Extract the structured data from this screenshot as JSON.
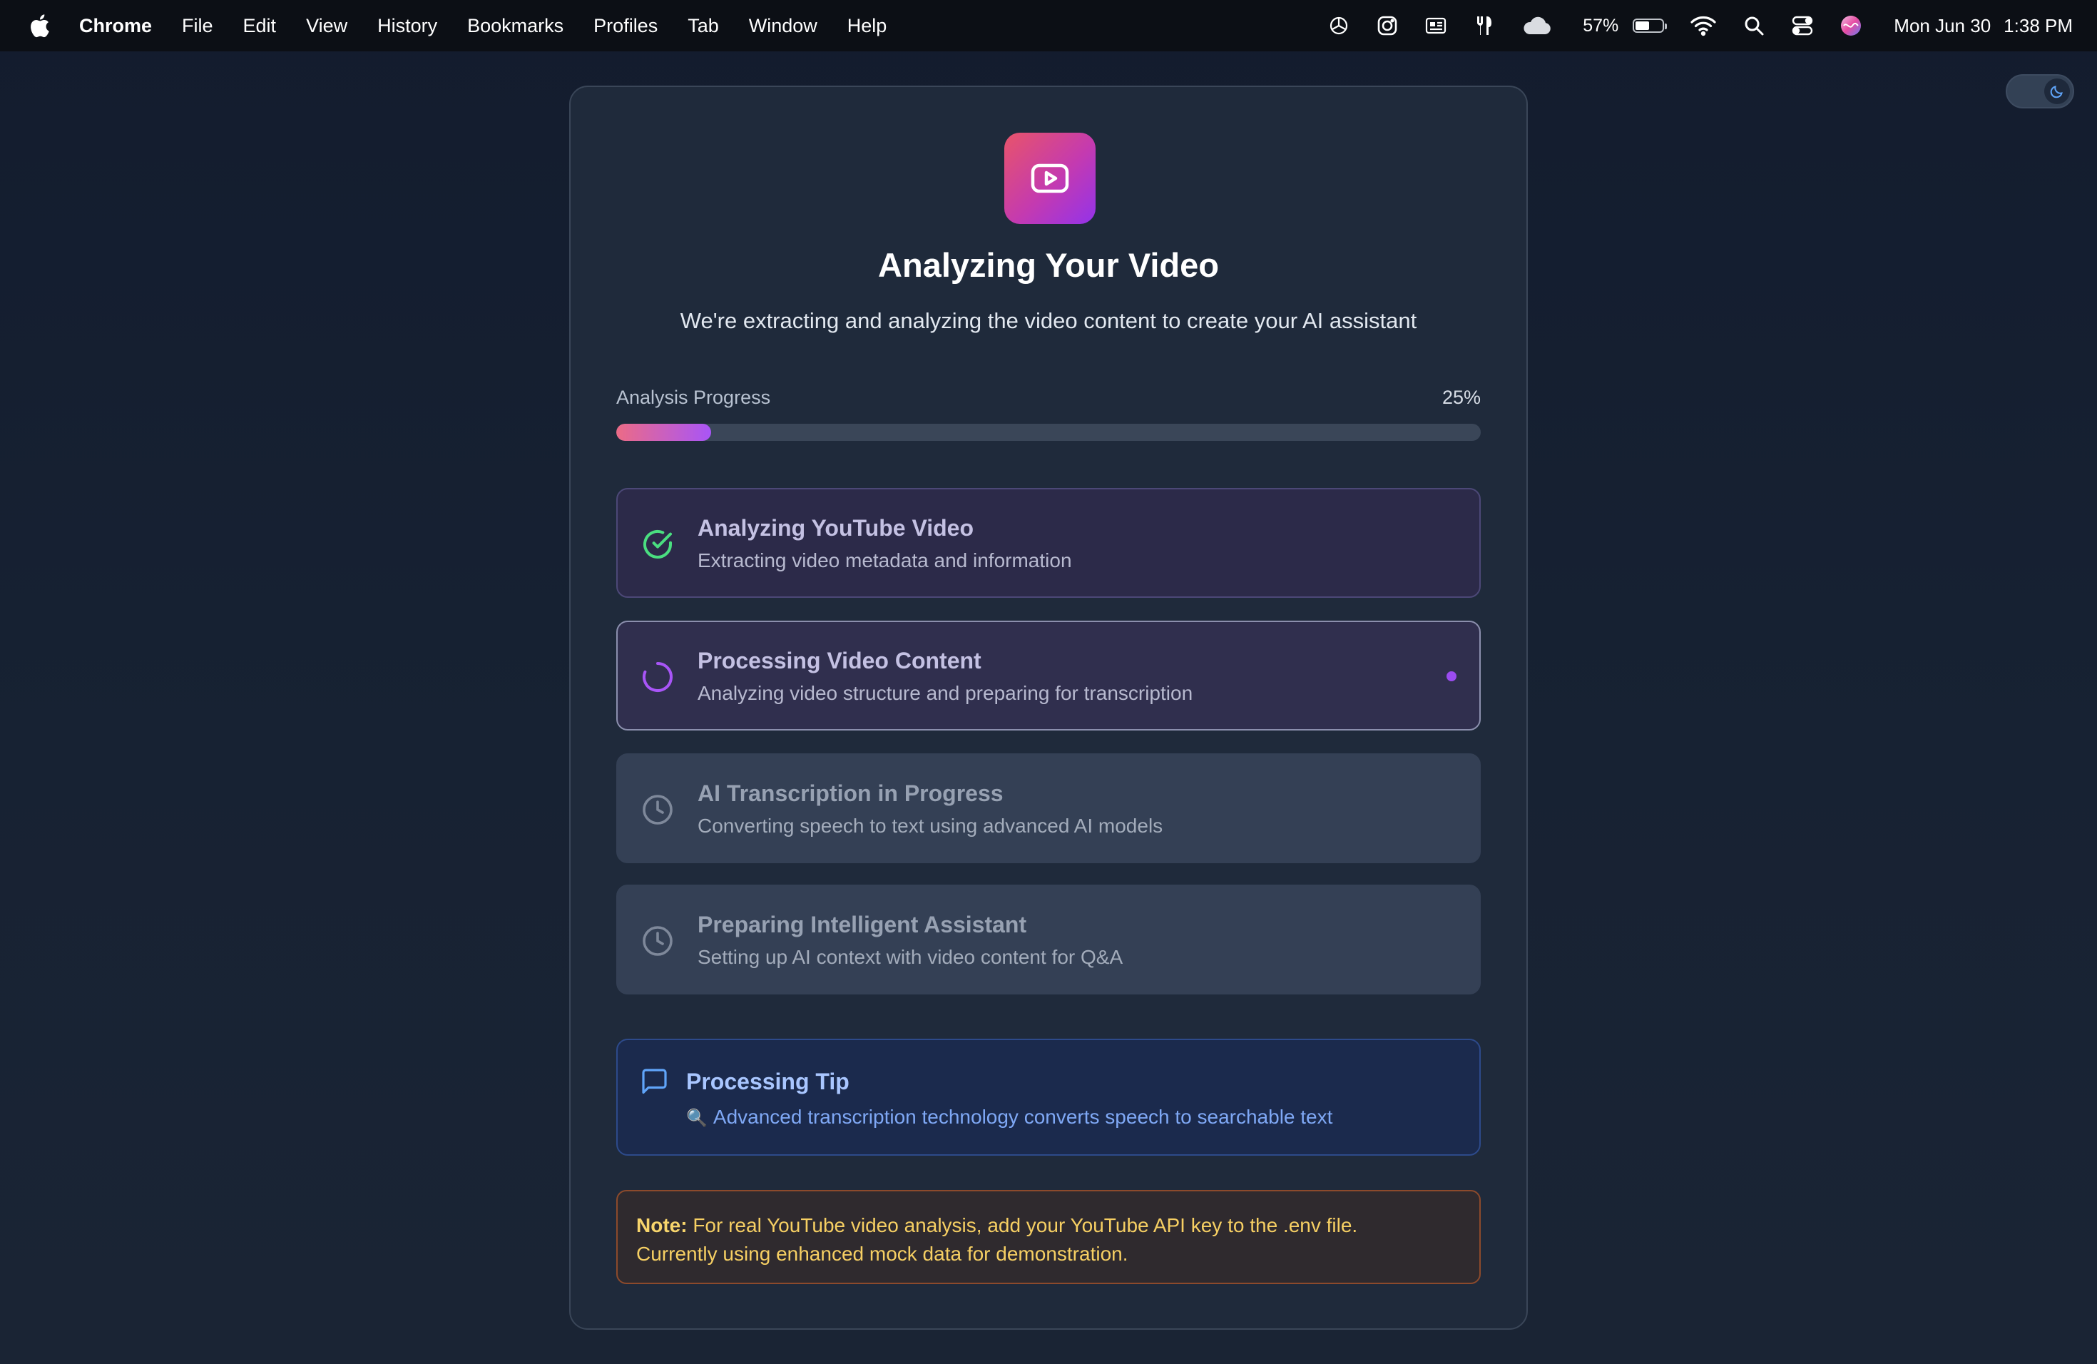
{
  "menubar": {
    "app_name": "Chrome",
    "items": [
      "File",
      "Edit",
      "View",
      "History",
      "Bookmarks",
      "Profiles",
      "Tab",
      "Window",
      "Help"
    ],
    "battery_percent": "57%",
    "battery_level": 0.57,
    "date": "Mon Jun 30",
    "time": "1:38 PM"
  },
  "header": {
    "title": "Analyzing Your Video",
    "subtitle": "We're extracting and analyzing the video content to create your AI assistant"
  },
  "progress": {
    "label": "Analysis Progress",
    "percent_label": "25%",
    "value": 0.11
  },
  "steps": [
    {
      "title": "Analyzing YouTube Video",
      "description": "Extracting video metadata and information",
      "status": "done"
    },
    {
      "title": "Processing Video Content",
      "description": "Analyzing video structure and preparing for transcription",
      "status": "active"
    },
    {
      "title": "AI Transcription in Progress",
      "description": "Converting speech to text using advanced AI models",
      "status": "pending"
    },
    {
      "title": "Preparing Intelligent Assistant",
      "description": "Setting up AI context with video content for Q&A",
      "status": "pending"
    }
  ],
  "tip": {
    "title": "Processing Tip",
    "emoji": "🔍",
    "text": "Advanced transcription technology converts speech to searchable text"
  },
  "note": {
    "label": "Note:",
    "line1": "For real YouTube video analysis, add your YouTube API key to the .env file.",
    "line2": "Currently using enhanced mock data for demonstration."
  },
  "colors": {
    "accent_gradient_start": "#ec6b86",
    "accent_gradient_end": "#a855f7",
    "done_green": "#4ade80",
    "active_purple": "#9b4cf0",
    "tip_blue": "#7fa8f5",
    "note_amber": "#f6cf63"
  },
  "icons": {
    "app_logo": "play-icon",
    "done": "check-circle-icon",
    "active": "spinner-icon",
    "pending": "clock-icon",
    "tip": "message-square-icon",
    "theme": "moon-icon"
  }
}
